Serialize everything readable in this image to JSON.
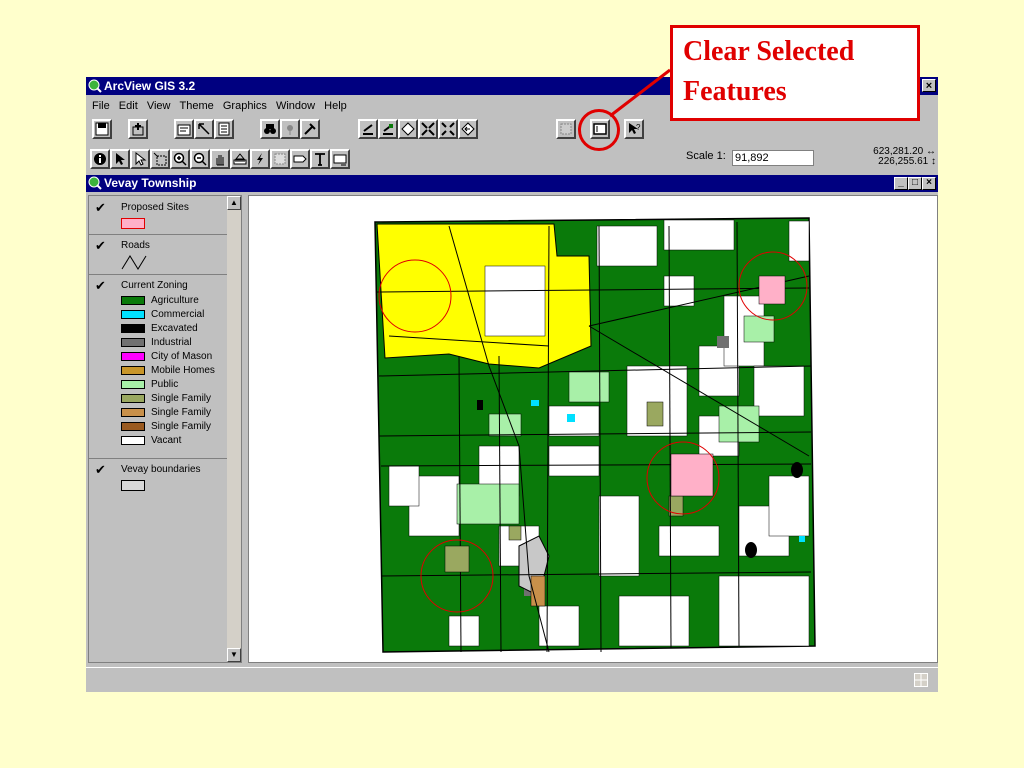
{
  "app": {
    "title": "ArcView GIS 3.2"
  },
  "menu": [
    "File",
    "Edit",
    "View",
    "Theme",
    "Graphics",
    "Window",
    "Help"
  ],
  "toolbar": {
    "scale_label": "Scale 1:",
    "scale_value": "91,892",
    "coord_x": "623,281.20",
    "coord_y": "226,255.61"
  },
  "view": {
    "title": "Vevay Township"
  },
  "legend": {
    "themes": [
      {
        "name": "Proposed Sites",
        "classes": [
          {
            "label": "",
            "color": "#ffb0c8"
          }
        ]
      },
      {
        "name": "Roads",
        "classes": []
      },
      {
        "name": "Current Zoning",
        "classes": [
          {
            "label": "Agriculture",
            "color": "#0a7a0a"
          },
          {
            "label": "Commercial",
            "color": "#00e0ff"
          },
          {
            "label": "Excavated",
            "color": "#000000"
          },
          {
            "label": "Industrial",
            "color": "#707070"
          },
          {
            "label": "City of Mason",
            "color": "#ff00ff"
          },
          {
            "label": "Mobile Homes",
            "color": "#c8962a"
          },
          {
            "label": "Public",
            "color": "#a8f0a8"
          },
          {
            "label": "Single Family",
            "color": "#9aa860"
          },
          {
            "label": "Single Family",
            "color": "#c8904a"
          },
          {
            "label": "Single Family",
            "color": "#9a5a20"
          },
          {
            "label": "Vacant",
            "color": "#ffffff"
          }
        ]
      },
      {
        "name": "Vevay boundaries",
        "classes": [
          {
            "label": "",
            "color": "#d8d8d8"
          }
        ]
      }
    ]
  },
  "callout": {
    "line1": "Clear Selected",
    "line2": "Features"
  },
  "colors": {
    "agriculture": "#0a7a0a",
    "industrial_yellow": "#ffff00",
    "highlight": "#e00000",
    "titlebar": "#000080"
  }
}
